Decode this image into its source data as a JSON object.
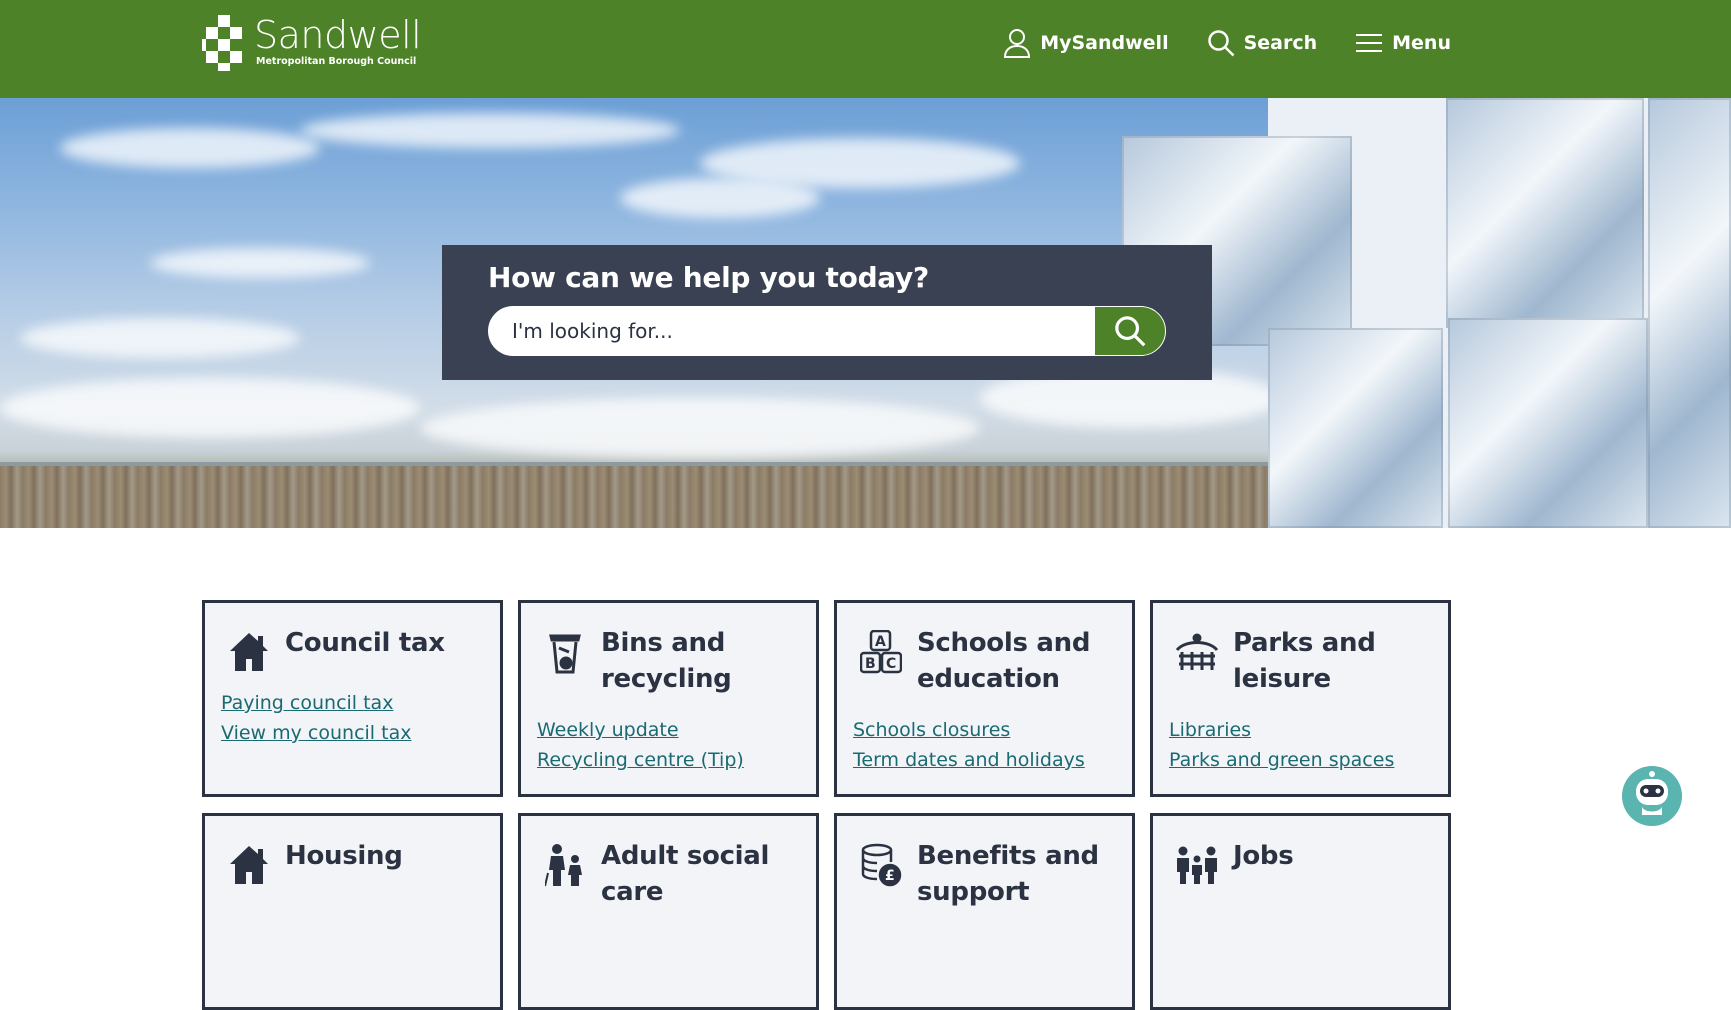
{
  "header": {
    "logo_name": "Sandwell",
    "logo_sub": "Metropolitan Borough Council",
    "nav": [
      {
        "label": "MySandwell",
        "icon": "user-icon"
      },
      {
        "label": "Search",
        "icon": "search-icon"
      },
      {
        "label": "Menu",
        "icon": "menu-icon"
      }
    ]
  },
  "hero": {
    "title": "How can we help you today?",
    "search_placeholder": "I'm looking for..."
  },
  "cards": [
    {
      "title": "Council tax",
      "icon": "house-icon",
      "links": [
        "Paying council tax",
        "View my council tax"
      ]
    },
    {
      "title": "Bins and recycling",
      "icon": "bin-icon",
      "links": [
        "Weekly update",
        "Recycling centre (Tip)"
      ]
    },
    {
      "title": "Schools and education",
      "icon": "abc-blocks-icon",
      "links": [
        "Schools closures",
        "Term dates and holidays"
      ]
    },
    {
      "title": "Parks and leisure",
      "icon": "park-icon",
      "links": [
        "Libraries",
        "Parks and green spaces"
      ]
    },
    {
      "title": "Housing",
      "icon": "house-icon",
      "links": []
    },
    {
      "title": "Adult social care",
      "icon": "adult-care-icon",
      "links": []
    },
    {
      "title": "Benefits and support",
      "icon": "coins-icon",
      "links": []
    },
    {
      "title": "Jobs",
      "icon": "people-icon",
      "links": []
    }
  ],
  "colors": {
    "header_green": "#4d8228",
    "panel": "#394152",
    "link": "#1a6a72"
  }
}
